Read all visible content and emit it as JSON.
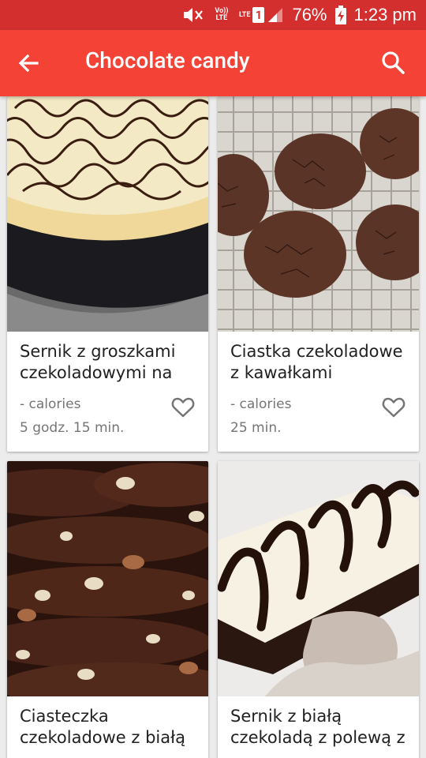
{
  "status_bar": {
    "volte_label": "Vo)) LTE",
    "lte_label": "LTE",
    "sim_slot": "1",
    "battery_percent": "76%",
    "time": "1:23 pm"
  },
  "app_bar": {
    "title": "Chocolate candy",
    "back_icon": "arrow-back-icon",
    "search_icon": "search-icon",
    "color": "#f44336"
  },
  "recipes": [
    {
      "title": "Sernik z groszkami czekoladowymi na",
      "calories": "- calories",
      "time": "5 godz. 15 min."
    },
    {
      "title": "Ciastka czekoladowe z kawałkami",
      "calories": "- calories",
      "time": "25 min."
    },
    {
      "title": "Ciasteczka czekoladowe z białą",
      "calories": "",
      "time": ""
    },
    {
      "title": "Sernik z białą czekoladą z polewą z",
      "calories": "",
      "time": ""
    }
  ]
}
